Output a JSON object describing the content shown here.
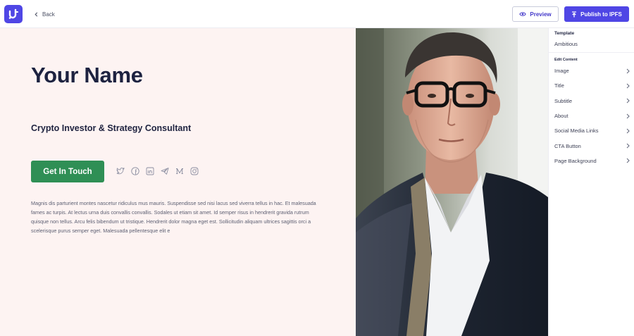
{
  "header": {
    "logo_icon": "brand-logo-icon",
    "back_label": "Back",
    "preview_label": "Preview",
    "publish_label": "Publish to IPFS"
  },
  "profile": {
    "name": "Your Name",
    "title": "Crypto Investor & Strategy Consultant",
    "cta_label": "Get In Touch",
    "about": "Magnis dis parturient montes nascetur ridiculus mus mauris. Suspendisse sed nisi lacus sed viverra tellus in hac. Et malesuada fames ac turpis. At lectus urna duis convallis convallis. Sodales ut etiam sit amet. Id semper risus in hendrerit gravida rutrum quisque non tellus. Arcu felis bibendum ut tristique. Hendrerit dolor magna eget est. Sollicitudin aliquam ultrices sagittis orci a scelerisque purus semper eget. Malesuada pellentesque elit e",
    "social_icons": [
      "twitter-icon",
      "facebook-icon",
      "linkedin-icon",
      "telegram-icon",
      "medium-icon",
      "instagram-icon"
    ]
  },
  "panel": {
    "template_heading": "Template",
    "template_value": "Ambitious",
    "edit_heading": "Edit Content",
    "items": [
      {
        "label": "Image"
      },
      {
        "label": "Title"
      },
      {
        "label": "Subtitle"
      },
      {
        "label": "About"
      },
      {
        "label": "Social Media Links"
      },
      {
        "label": "CTA Button"
      },
      {
        "label": "Page Background"
      }
    ]
  },
  "colors": {
    "brand": "#4f46e5",
    "cta": "#2f8f55",
    "canvas_bg": "#fdf3f2",
    "heading": "#1d2240"
  }
}
